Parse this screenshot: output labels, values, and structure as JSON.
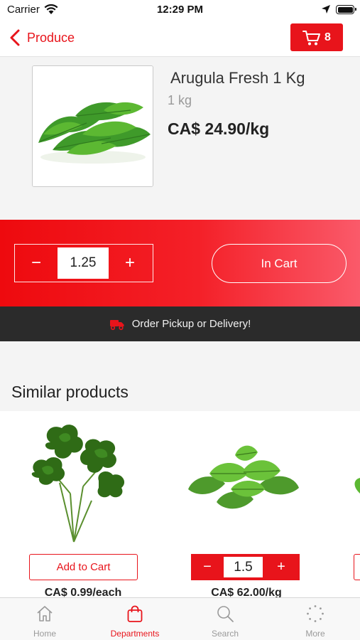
{
  "status_bar": {
    "carrier": "Carrier",
    "time": "12:29 PM"
  },
  "nav": {
    "back_label": "Produce",
    "cart_count": "8"
  },
  "product": {
    "name": "Arugula Fresh 1 Kg",
    "unit": "1 kg",
    "price": "CA$ 24.90/kg",
    "quantity": "1.25",
    "decrement": "−",
    "increment": "+",
    "cart_button": "In Cart"
  },
  "order_bar": {
    "label": "Order Pickup or Delivery!"
  },
  "similar": {
    "title": "Similar products",
    "items": [
      {
        "add_label": "Add to Cart",
        "price": "CA$ 0.99/each"
      },
      {
        "quantity": "1.5",
        "decrement": "−",
        "increment": "+",
        "price": "CA$ 62.00/kg"
      }
    ]
  },
  "tabs": [
    {
      "label": "Home",
      "icon": "home-icon"
    },
    {
      "label": "Departments",
      "icon": "shopping-bag-icon",
      "active": true
    },
    {
      "label": "Search",
      "icon": "search-icon"
    },
    {
      "label": "More",
      "icon": "more-icon"
    }
  ],
  "colors": {
    "accent": "#e8141b",
    "order_bar": "#2b2b2b",
    "background": "#f4f4f4"
  }
}
